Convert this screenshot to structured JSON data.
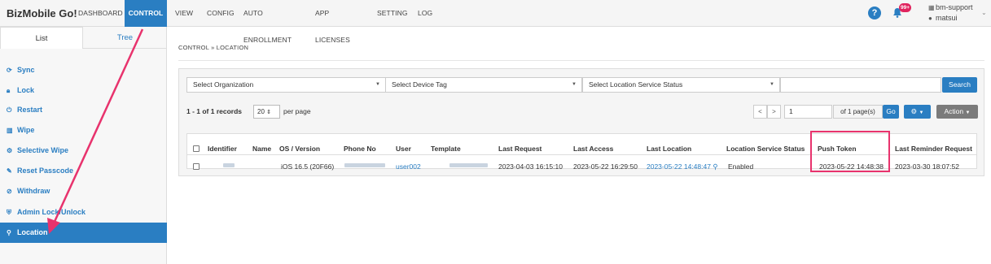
{
  "app": {
    "brand": "BizMobile Go!"
  },
  "nav": {
    "items": [
      {
        "label": "DASHBOARD"
      },
      {
        "label": "CONTROL"
      },
      {
        "label": "VIEW"
      },
      {
        "label": "CONFIG"
      },
      {
        "label": "AUTO ENROLLMENT"
      },
      {
        "label": "APP LICENSES"
      },
      {
        "label": "SETTING"
      },
      {
        "label": "LOG"
      }
    ],
    "active": "CONTROL"
  },
  "header": {
    "notification_count": "99+",
    "user_org": "bm-support",
    "user_name": "matsui",
    "help_glyph": "?"
  },
  "sidebar": {
    "tabs": [
      {
        "label": "List"
      },
      {
        "label": "Tree"
      }
    ],
    "items": [
      {
        "label": "Sync",
        "icon": "sync-icon"
      },
      {
        "label": "Lock",
        "icon": "lock-icon"
      },
      {
        "label": "Restart",
        "icon": "power-icon"
      },
      {
        "label": "Wipe",
        "icon": "trash-icon"
      },
      {
        "label": "Selective Wipe",
        "icon": "gear-icon"
      },
      {
        "label": "Reset Passcode",
        "icon": "eraser-icon"
      },
      {
        "label": "Withdraw",
        "icon": "ban-icon"
      },
      {
        "label": "Admin Lock/Unlock",
        "icon": "shield-icon"
      },
      {
        "label": "Location",
        "icon": "map-marker-icon"
      }
    ],
    "active": "Location"
  },
  "breadcrumb": "CONTROL » LOCATION",
  "filters": {
    "organization": "Select Organization",
    "device_tag": "Select Device Tag",
    "location_status": "Select Location Service Status",
    "search_value": "",
    "search_label": "Search"
  },
  "pagination": {
    "records": "1 - 1 of 1 records",
    "per_page": "20",
    "per_page_label": "per page",
    "prev": "<",
    "next": ">",
    "page": "1",
    "page_of": "of 1 page(s)",
    "go_label": "Go",
    "action_label": "Action"
  },
  "table": {
    "columns": [
      "Identifier",
      "Name",
      "OS / Version",
      "Phone No",
      "User",
      "Template",
      "Last Request",
      "Last Access",
      "Last Location",
      "Location Service Status",
      "Push Token",
      "Last Reminder Request"
    ],
    "rows": [
      {
        "identifier": "",
        "name": "",
        "os_version": "iOS 16.5 (20F66)",
        "phone_no": "",
        "user": "user002",
        "template": "",
        "last_request": "2023-04-03 16:15:10",
        "last_access": "2023-05-22 16:29:50",
        "last_location": "2023-05-22 14:48:47",
        "location_service_status": "Enabled",
        "push_token": "2023-05-22 14:48:38",
        "last_reminder_request": "2023-03-30 18:07:52"
      }
    ]
  },
  "colors": {
    "accent": "#2a7ec2",
    "highlight": "#e8336d",
    "badge": "#e0245e"
  }
}
